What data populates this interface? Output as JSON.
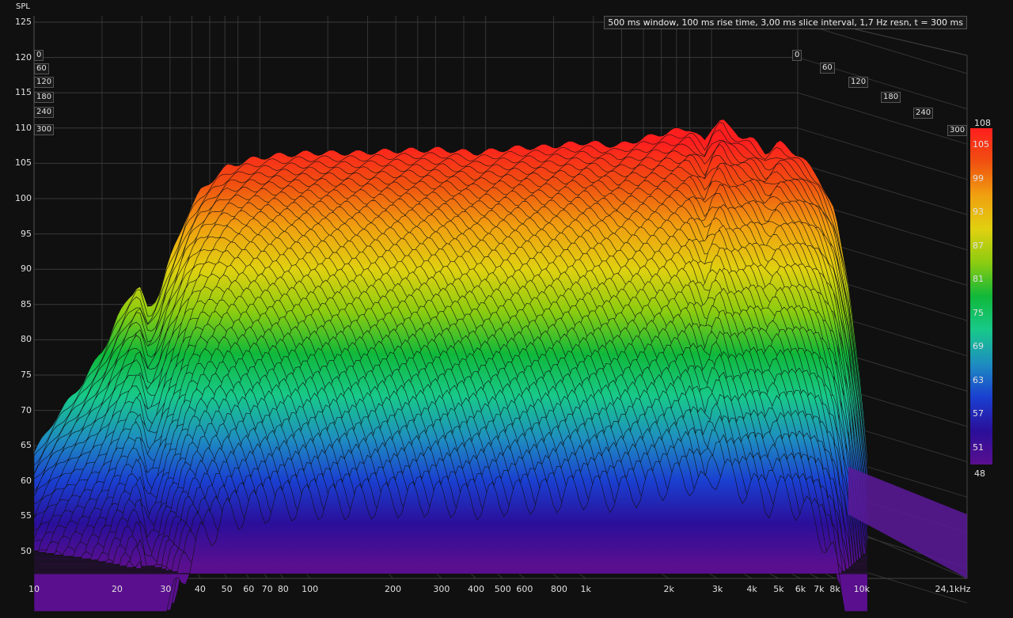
{
  "chart_data": {
    "type": "waterfall",
    "y_axis_label": "SPL",
    "info_text": "500 ms window, 100 ms rise time, 3,00 ms slice interval, 1,7 Hz resn, t = 300 ms",
    "y_ticks": [
      125,
      120,
      115,
      110,
      105,
      100,
      95,
      90,
      85,
      80,
      75,
      70,
      65,
      60,
      55,
      50
    ],
    "ylim": [
      46,
      126
    ],
    "x_scale": "log",
    "xlim": [
      10,
      24100
    ],
    "x_ticks": [
      {
        "value": 10,
        "label": "10"
      },
      {
        "value": 20,
        "label": "20"
      },
      {
        "value": 30,
        "label": "30"
      },
      {
        "value": 40,
        "label": "40"
      },
      {
        "value": 50,
        "label": "50"
      },
      {
        "value": 60,
        "label": "60"
      },
      {
        "value": 70,
        "label": "70"
      },
      {
        "value": 80,
        "label": "80"
      },
      {
        "value": 100,
        "label": "100"
      },
      {
        "value": 200,
        "label": "200"
      },
      {
        "value": 300,
        "label": "300"
      },
      {
        "value": 400,
        "label": "400"
      },
      {
        "value": 500,
        "label": "500"
      },
      {
        "value": 600,
        "label": "600"
      },
      {
        "value": 800,
        "label": "800"
      },
      {
        "value": 1000,
        "label": "1k"
      },
      {
        "value": 2000,
        "label": "2k"
      },
      {
        "value": 3000,
        "label": "3k"
      },
      {
        "value": 4000,
        "label": "4k"
      },
      {
        "value": 5000,
        "label": "5k"
      },
      {
        "value": 6000,
        "label": "6k"
      },
      {
        "value": 7000,
        "label": "7k"
      },
      {
        "value": 8000,
        "label": "8k"
      },
      {
        "value": 10000,
        "label": "10k"
      },
      {
        "value": 24100,
        "label": "24,1kHz"
      }
    ],
    "time_ticks_ms": [
      {
        "value": 0,
        "label": "0"
      },
      {
        "value": 60,
        "label": "60"
      },
      {
        "value": 120,
        "label": "120"
      },
      {
        "value": 180,
        "label": "180"
      },
      {
        "value": 240,
        "label": "240"
      },
      {
        "value": 300,
        "label": "300"
      }
    ],
    "colorbar": {
      "range": [
        48,
        108
      ],
      "ticks": [
        {
          "value": 108,
          "label": "108"
        },
        {
          "value": 105,
          "label": "105"
        },
        {
          "value": 99,
          "label": "99"
        },
        {
          "value": 93,
          "label": "93"
        },
        {
          "value": 87,
          "label": "87"
        },
        {
          "value": 81,
          "label": "81"
        },
        {
          "value": 75,
          "label": "75"
        },
        {
          "value": 69,
          "label": "69"
        },
        {
          "value": 63,
          "label": "63"
        },
        {
          "value": 57,
          "label": "57"
        },
        {
          "value": 51,
          "label": "51"
        },
        {
          "value": 48,
          "label": "48"
        }
      ],
      "colors": [
        "#5a0f8f",
        "#2a0f9a",
        "#1a3fd0",
        "#1e8ec0",
        "#18c98a",
        "#10b83a",
        "#8ccc10",
        "#e0d010",
        "#f0a010",
        "#f05010",
        "#ff1e1e"
      ]
    },
    "spectrum_t0": {
      "freq_hz": [
        10,
        12,
        15,
        18,
        20,
        22,
        24,
        26,
        28,
        30,
        33,
        36,
        40,
        45,
        50,
        60,
        70,
        80,
        100,
        150,
        200,
        300,
        400,
        500,
        600,
        700,
        800,
        1000,
        1300,
        1600,
        2000,
        2400,
        2700,
        2900,
        3100,
        3300,
        3600,
        4000,
        4500,
        5000,
        5500,
        6000,
        7000,
        8000,
        9000,
        10000,
        10500
      ],
      "spl_db": [
        64,
        69,
        74,
        79,
        83,
        86,
        88,
        84,
        86,
        90,
        94,
        98,
        101,
        103,
        104.5,
        105.5,
        106,
        106.2,
        106.5,
        106.5,
        106.8,
        107,
        106.5,
        107,
        107.3,
        107.3,
        107.6,
        108,
        107.5,
        108.5,
        109.5,
        110,
        108,
        110.5,
        111.5,
        110,
        109,
        108.5,
        106.5,
        108,
        107,
        106,
        103,
        98,
        88,
        72,
        63
      ]
    },
    "decay_db_over_window": 45
  }
}
